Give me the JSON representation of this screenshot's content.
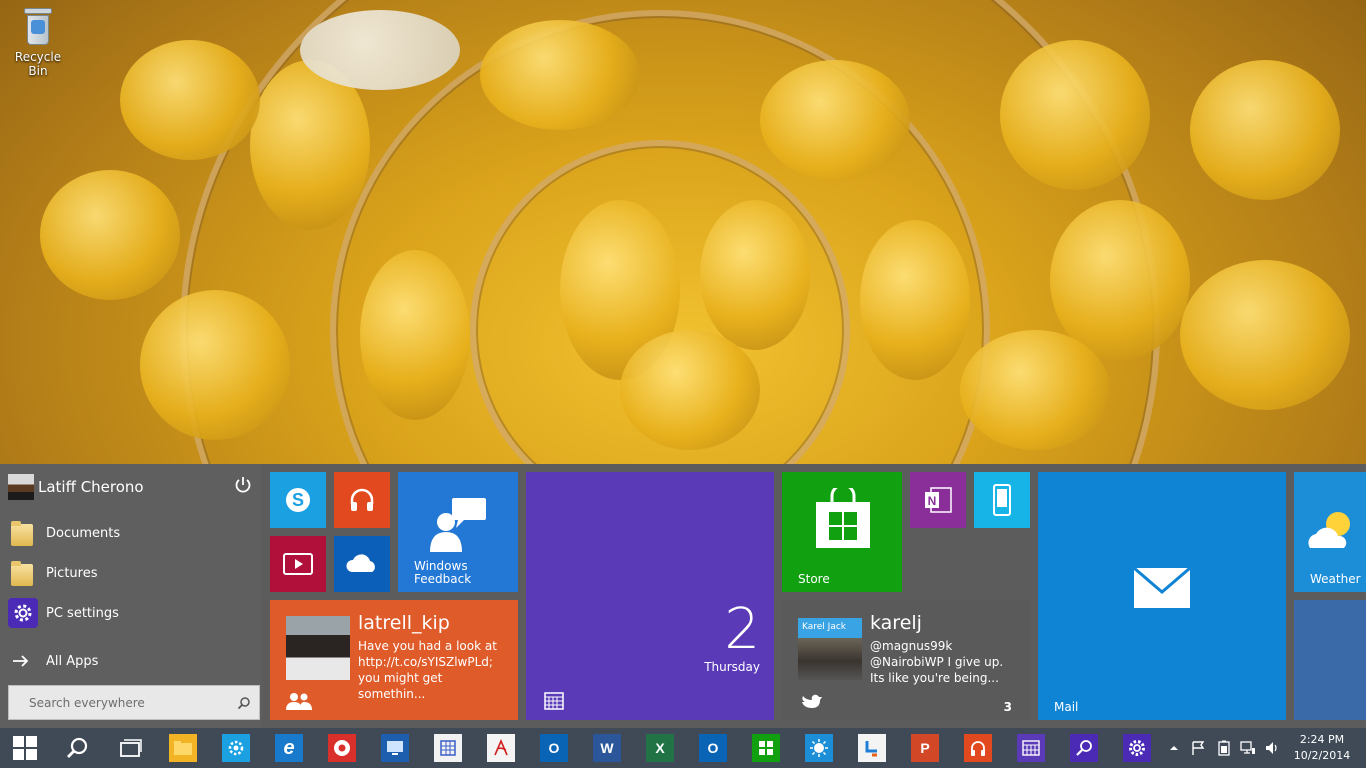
{
  "desktop": {
    "recycle_bin_label": "Recycle Bin"
  },
  "start_menu": {
    "user_name": "Latiff Cherono",
    "items": [
      {
        "label": "Documents",
        "icon": "folder-icon"
      },
      {
        "label": "Pictures",
        "icon": "folder-icon"
      },
      {
        "label": "PC settings",
        "icon": "gear-icon"
      }
    ],
    "all_apps_label": "All Apps",
    "search_placeholder": "Search everywhere"
  },
  "tiles": {
    "windows_feedback": "Windows\nFeedback",
    "people": {
      "handle": "latrell_kip",
      "text": "Have you had a look at http://t.co/sYISZlwPLd; you might get somethin..."
    },
    "calendar": {
      "day_number": "2",
      "day_name": "Thursday"
    },
    "store": "Store",
    "twitter": {
      "badge_name": "Karel Jack",
      "name": "karelj",
      "text": "@magnus99k @NairobiWP I give up. Its like you're being...",
      "count": "3"
    },
    "mail": "Mail",
    "weather": "Weather"
  },
  "colors": {
    "skype": "#1ba1e2",
    "music": "#e3491f",
    "video": "#b0103a",
    "onedrive": "#0b5fb8",
    "feedback": "#2378d6",
    "people": "#e05b2a",
    "calendar": "#5b3ab8",
    "store": "#10a010",
    "onenote": "#8a2f9a",
    "phone": "#17b4e8",
    "twitter": "#5a5a5a",
    "mail": "#0f83d4",
    "weather": "#1c8ed8",
    "weather2": "#3a6aa8"
  },
  "taskbar": {
    "apps": [
      "start-icon",
      "search-icon",
      "task-view-icon",
      "file-explorer-icon",
      "settings-icon",
      "internet-explorer-icon",
      "chrome-icon",
      "remote-desktop-icon",
      "calculator-icon",
      "acrobat-icon",
      "outlook-icon",
      "word-icon",
      "excel-icon",
      "outlook-icon",
      "store-icon",
      "weather-icon",
      "people-icon",
      "powerpoint-icon",
      "music-icon",
      "calendar-icon",
      "search-app-icon",
      "pc-settings-icon"
    ],
    "letters": {
      "outlook": "O",
      "word": "W",
      "excel": "X",
      "powerpoint": "P"
    },
    "clock_time": "2:24 PM",
    "clock_date": "10/2/2014"
  }
}
